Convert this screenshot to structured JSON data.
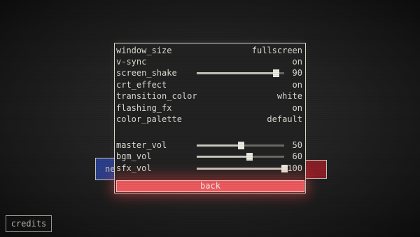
{
  "settings": {
    "window_size": {
      "label": "window_size",
      "value": "fullscreen"
    },
    "v_sync": {
      "label": "v-sync",
      "value": "on"
    },
    "screen_shake": {
      "label": "screen_shake",
      "value": "90",
      "level": 90
    },
    "crt_effect": {
      "label": "crt_effect",
      "value": "on"
    },
    "transition_color": {
      "label": "transition_color",
      "value": "white"
    },
    "flashing_fx": {
      "label": "flashing_fx",
      "value": "on"
    },
    "color_palette": {
      "label": "color_palette",
      "value": "default"
    },
    "master_vol": {
      "label": "master_vol",
      "value": "50",
      "level": 50
    },
    "bgm_vol": {
      "label": "bgm_vol",
      "value": "60",
      "level": 60
    },
    "sfx_vol": {
      "label": "sfx_vol",
      "value": "100",
      "level": 100
    }
  },
  "back_label": "back",
  "credits_label": "credits",
  "background_button_text": "ne",
  "colors": {
    "accent_red": "#ee5a5e",
    "panel_border": "#dcdcd0",
    "text": "#dcdcd4",
    "bg_blue": "#2c3f8a",
    "bg_red": "#8a1f26"
  }
}
